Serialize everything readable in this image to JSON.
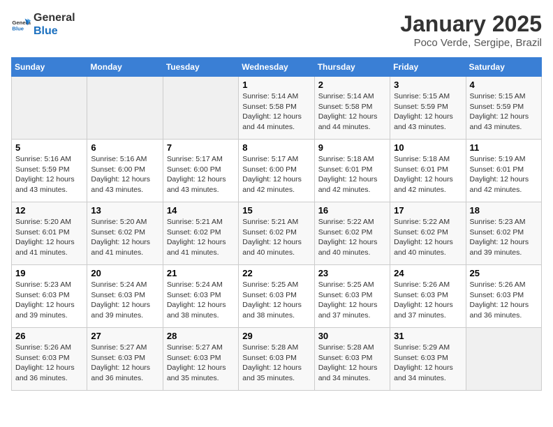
{
  "logo": {
    "line1": "General",
    "line2": "Blue"
  },
  "title": "January 2025",
  "subtitle": "Poco Verde, Sergipe, Brazil",
  "headers": [
    "Sunday",
    "Monday",
    "Tuesday",
    "Wednesday",
    "Thursday",
    "Friday",
    "Saturday"
  ],
  "weeks": [
    [
      {
        "num": "",
        "info": ""
      },
      {
        "num": "",
        "info": ""
      },
      {
        "num": "",
        "info": ""
      },
      {
        "num": "1",
        "info": "Sunrise: 5:14 AM\nSunset: 5:58 PM\nDaylight: 12 hours\nand 44 minutes."
      },
      {
        "num": "2",
        "info": "Sunrise: 5:14 AM\nSunset: 5:58 PM\nDaylight: 12 hours\nand 44 minutes."
      },
      {
        "num": "3",
        "info": "Sunrise: 5:15 AM\nSunset: 5:59 PM\nDaylight: 12 hours\nand 43 minutes."
      },
      {
        "num": "4",
        "info": "Sunrise: 5:15 AM\nSunset: 5:59 PM\nDaylight: 12 hours\nand 43 minutes."
      }
    ],
    [
      {
        "num": "5",
        "info": "Sunrise: 5:16 AM\nSunset: 5:59 PM\nDaylight: 12 hours\nand 43 minutes."
      },
      {
        "num": "6",
        "info": "Sunrise: 5:16 AM\nSunset: 6:00 PM\nDaylight: 12 hours\nand 43 minutes."
      },
      {
        "num": "7",
        "info": "Sunrise: 5:17 AM\nSunset: 6:00 PM\nDaylight: 12 hours\nand 43 minutes."
      },
      {
        "num": "8",
        "info": "Sunrise: 5:17 AM\nSunset: 6:00 PM\nDaylight: 12 hours\nand 42 minutes."
      },
      {
        "num": "9",
        "info": "Sunrise: 5:18 AM\nSunset: 6:01 PM\nDaylight: 12 hours\nand 42 minutes."
      },
      {
        "num": "10",
        "info": "Sunrise: 5:18 AM\nSunset: 6:01 PM\nDaylight: 12 hours\nand 42 minutes."
      },
      {
        "num": "11",
        "info": "Sunrise: 5:19 AM\nSunset: 6:01 PM\nDaylight: 12 hours\nand 42 minutes."
      }
    ],
    [
      {
        "num": "12",
        "info": "Sunrise: 5:20 AM\nSunset: 6:01 PM\nDaylight: 12 hours\nand 41 minutes."
      },
      {
        "num": "13",
        "info": "Sunrise: 5:20 AM\nSunset: 6:02 PM\nDaylight: 12 hours\nand 41 minutes."
      },
      {
        "num": "14",
        "info": "Sunrise: 5:21 AM\nSunset: 6:02 PM\nDaylight: 12 hours\nand 41 minutes."
      },
      {
        "num": "15",
        "info": "Sunrise: 5:21 AM\nSunset: 6:02 PM\nDaylight: 12 hours\nand 40 minutes."
      },
      {
        "num": "16",
        "info": "Sunrise: 5:22 AM\nSunset: 6:02 PM\nDaylight: 12 hours\nand 40 minutes."
      },
      {
        "num": "17",
        "info": "Sunrise: 5:22 AM\nSunset: 6:02 PM\nDaylight: 12 hours\nand 40 minutes."
      },
      {
        "num": "18",
        "info": "Sunrise: 5:23 AM\nSunset: 6:02 PM\nDaylight: 12 hours\nand 39 minutes."
      }
    ],
    [
      {
        "num": "19",
        "info": "Sunrise: 5:23 AM\nSunset: 6:03 PM\nDaylight: 12 hours\nand 39 minutes."
      },
      {
        "num": "20",
        "info": "Sunrise: 5:24 AM\nSunset: 6:03 PM\nDaylight: 12 hours\nand 39 minutes."
      },
      {
        "num": "21",
        "info": "Sunrise: 5:24 AM\nSunset: 6:03 PM\nDaylight: 12 hours\nand 38 minutes."
      },
      {
        "num": "22",
        "info": "Sunrise: 5:25 AM\nSunset: 6:03 PM\nDaylight: 12 hours\nand 38 minutes."
      },
      {
        "num": "23",
        "info": "Sunrise: 5:25 AM\nSunset: 6:03 PM\nDaylight: 12 hours\nand 37 minutes."
      },
      {
        "num": "24",
        "info": "Sunrise: 5:26 AM\nSunset: 6:03 PM\nDaylight: 12 hours\nand 37 minutes."
      },
      {
        "num": "25",
        "info": "Sunrise: 5:26 AM\nSunset: 6:03 PM\nDaylight: 12 hours\nand 36 minutes."
      }
    ],
    [
      {
        "num": "26",
        "info": "Sunrise: 5:26 AM\nSunset: 6:03 PM\nDaylight: 12 hours\nand 36 minutes."
      },
      {
        "num": "27",
        "info": "Sunrise: 5:27 AM\nSunset: 6:03 PM\nDaylight: 12 hours\nand 36 minutes."
      },
      {
        "num": "28",
        "info": "Sunrise: 5:27 AM\nSunset: 6:03 PM\nDaylight: 12 hours\nand 35 minutes."
      },
      {
        "num": "29",
        "info": "Sunrise: 5:28 AM\nSunset: 6:03 PM\nDaylight: 12 hours\nand 35 minutes."
      },
      {
        "num": "30",
        "info": "Sunrise: 5:28 AM\nSunset: 6:03 PM\nDaylight: 12 hours\nand 34 minutes."
      },
      {
        "num": "31",
        "info": "Sunrise: 5:29 AM\nSunset: 6:03 PM\nDaylight: 12 hours\nand 34 minutes."
      },
      {
        "num": "",
        "info": ""
      }
    ]
  ]
}
